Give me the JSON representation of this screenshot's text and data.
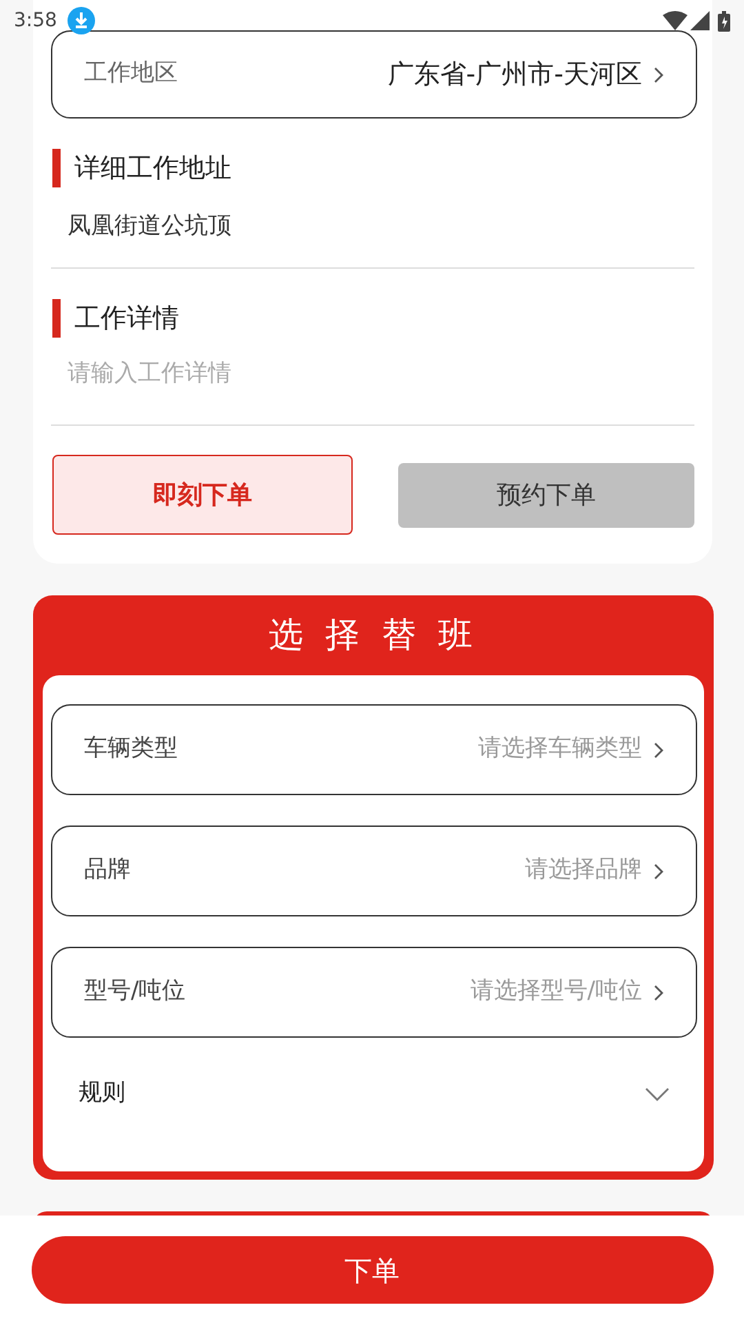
{
  "status_bar": {
    "time": "3:58"
  },
  "region": {
    "label": "工作地区",
    "value": "广东省-广州市-天河区"
  },
  "address": {
    "heading": "详细工作地址",
    "value": "凤凰街道公坑顶"
  },
  "details": {
    "heading": "工作详情",
    "placeholder": "请输入工作详情"
  },
  "order_types": [
    {
      "label": "即刻下单",
      "selected": true
    },
    {
      "label": "预约下单",
      "selected": false
    }
  ],
  "shift": {
    "title": "选 择 替 班",
    "fields": [
      {
        "label": "车辆类型",
        "placeholder": "请选择车辆类型"
      },
      {
        "label": "品牌",
        "placeholder": "请选择品牌"
      },
      {
        "label": "型号/吨位",
        "placeholder": "请选择型号/吨位"
      }
    ],
    "rule": {
      "label": "规则",
      "expanded": false
    }
  },
  "submit": "下单"
}
